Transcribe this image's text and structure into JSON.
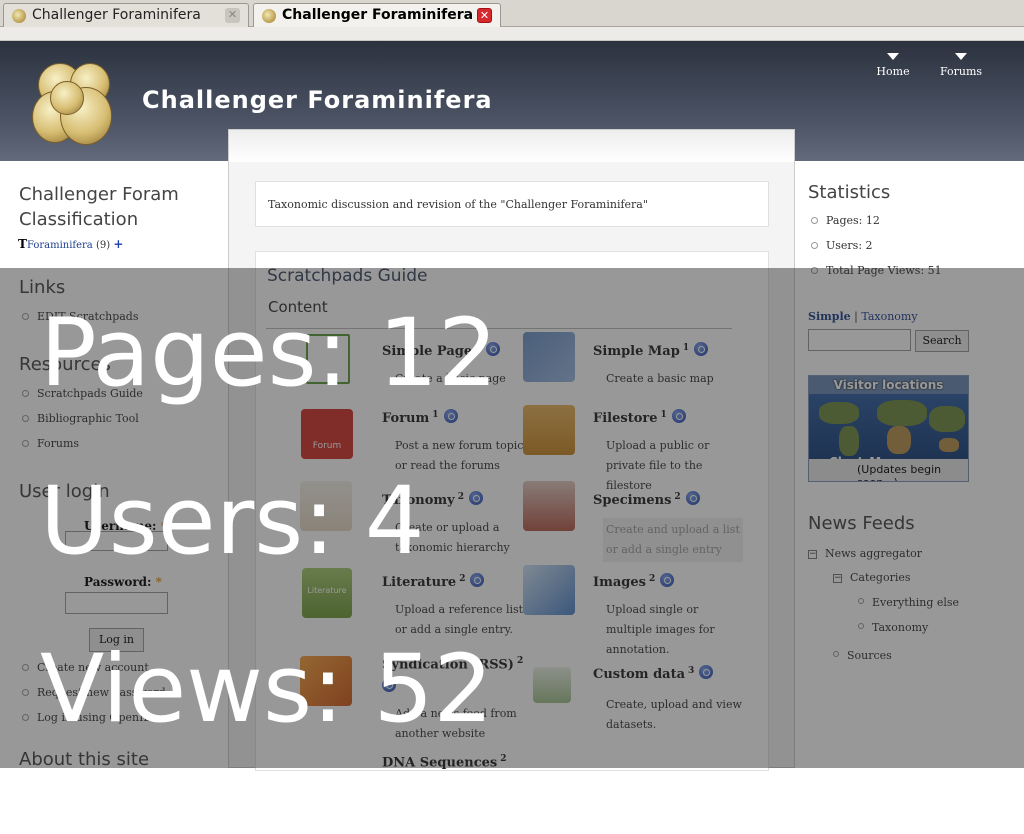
{
  "browser": {
    "tabs": [
      {
        "label": "Challenger Foraminifera",
        "active": false
      },
      {
        "label": "Challenger Foraminifera",
        "active": true
      }
    ]
  },
  "header": {
    "site_title": "Challenger Foraminifera",
    "nav": [
      {
        "label": "Home"
      },
      {
        "label": "Forums"
      }
    ]
  },
  "left_sidebar": {
    "classification": {
      "title": "Challenger Foram Classification",
      "item": "Foraminifera",
      "count": "(9)"
    },
    "links": {
      "title": "Links",
      "items": [
        "EDIT Scratchpads"
      ]
    },
    "resources": {
      "title": "Resources",
      "items": [
        "Scratchpads Guide",
        "Bibliographic Tool",
        "Forums"
      ]
    },
    "login": {
      "title": "User login",
      "username_label": "Username:",
      "password_label": "Password:",
      "required_mark": "*",
      "button": "Log in",
      "links": [
        "Create new account",
        "Request new password",
        "Log in using OpenID"
      ]
    },
    "about": {
      "title": "About this site"
    }
  },
  "main": {
    "mission": "Taxonomic discussion and revision of the \"Challenger Foraminifera\"",
    "guide": {
      "title": "Scratchpads Guide",
      "subtitle": "Content",
      "items": [
        {
          "title": "Simple Page",
          "sup": "1",
          "desc": "Create a basic page"
        },
        {
          "title": "Simple Map",
          "sup": "1",
          "desc": "Create a basic map"
        },
        {
          "title": "Forum",
          "sup": "1",
          "desc": "Post a new forum topic, or read the forums"
        },
        {
          "title": "Filestore",
          "sup": "1",
          "desc": "Upload a public or private file to the filestore"
        },
        {
          "title": "Taxonomy",
          "sup": "2",
          "desc": "Create or upload a taxonomic hierarchy"
        },
        {
          "title": "Specimens",
          "sup": "2",
          "desc": "Create and upload a list or add a single entry"
        },
        {
          "title": "Literature",
          "sup": "2",
          "desc": "Upload a reference list or add a single entry."
        },
        {
          "title": "Images",
          "sup": "2",
          "desc": "Upload single or multiple images for annotation."
        },
        {
          "title": "Syndication (RSS)",
          "sup": "2",
          "desc": "Add a news feed from another website"
        },
        {
          "title": "Custom data",
          "sup": "3",
          "desc": "Create, upload and view datasets."
        },
        {
          "title": "DNA Sequences",
          "sup": "2",
          "desc": ""
        }
      ],
      "icon_names": [
        "page-icon",
        "map-icon",
        "forum-icon",
        "filestore-icon",
        "taxonomy-icon",
        "specimens-icon",
        "literature-icon",
        "images-icon",
        "rss-icon",
        "custom-data-icon"
      ],
      "forum_icon_text": "Forum",
      "literature_icon_text": "Literature"
    }
  },
  "right_sidebar": {
    "statistics": {
      "title": "Statistics",
      "items": [
        "Pages: 12",
        "Users: 2",
        "Total Page Views: 51"
      ]
    },
    "search": {
      "tab_simple": "Simple",
      "sep": "|",
      "tab_taxonomy": "Taxonomy",
      "button": "Search"
    },
    "visitor_map": {
      "title": "Visitor locations",
      "brand": "ClustrMaps",
      "note": "(Updates begin soon...)"
    },
    "news": {
      "title": "News Feeds",
      "aggregator": "News aggregator",
      "categories": "Categories",
      "category_items": [
        "Everything else",
        "Taxonomy"
      ],
      "sources": "Sources"
    }
  },
  "overlay": {
    "lines": [
      "Pages: 12",
      "Users: 4",
      "Views: 52"
    ]
  },
  "colors": {
    "header_bg": "#3d4454",
    "link": "#1e3e8c",
    "overlay": "rgba(40,40,40,0.48)",
    "required": "#e39418"
  }
}
